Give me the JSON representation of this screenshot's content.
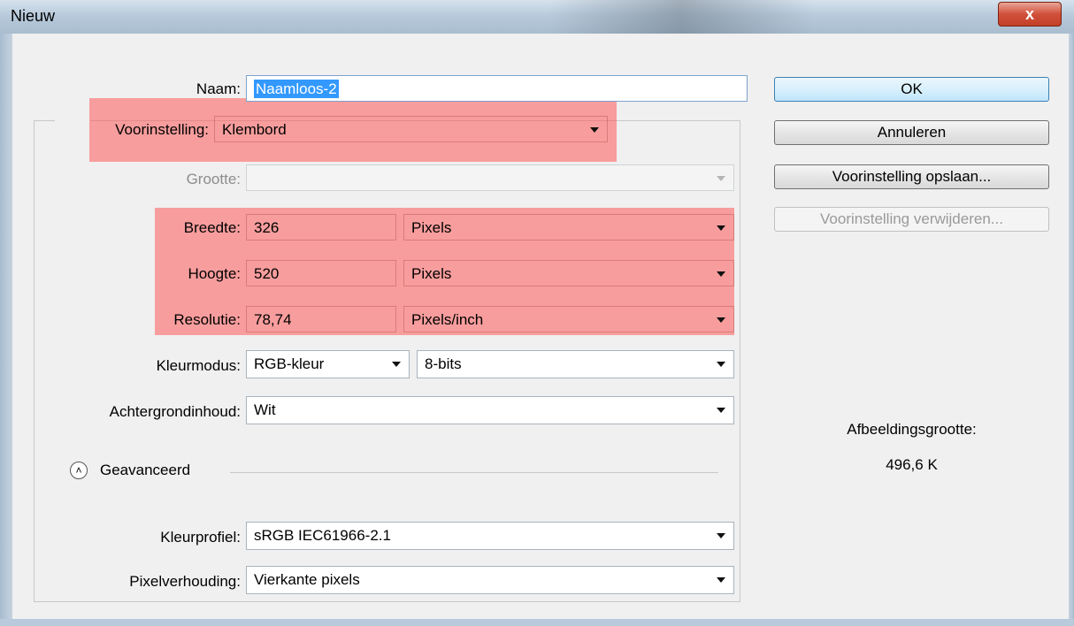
{
  "window": {
    "title": "Nieuw",
    "close_glyph": "x"
  },
  "form": {
    "name": {
      "label": "Naam:",
      "value": "Naamloos-2"
    },
    "preset": {
      "label": "Voorinstelling:",
      "value": "Klembord"
    },
    "size": {
      "label": "Grootte:",
      "value": ""
    },
    "width": {
      "label": "Breedte:",
      "value": "326",
      "unit": "Pixels"
    },
    "height": {
      "label": "Hoogte:",
      "value": "520",
      "unit": "Pixels"
    },
    "resolution": {
      "label": "Resolutie:",
      "value": "78,74",
      "unit": "Pixels/inch"
    },
    "color_mode": {
      "label": "Kleurmodus:",
      "value": "RGB-kleur",
      "bits": "8-bits"
    },
    "background": {
      "label": "Achtergrondinhoud:",
      "value": "Wit"
    },
    "advanced": {
      "label": "Geavanceerd",
      "icon": "collapse-up-icon"
    },
    "color_profile": {
      "label": "Kleurprofiel:",
      "value": "sRGB IEC61966-2.1"
    },
    "pixel_aspect": {
      "label": "Pixelverhouding:",
      "value": "Vierkante pixels"
    }
  },
  "buttons": {
    "ok": "OK",
    "cancel": "Annuleren",
    "save_preset": "Voorinstelling opslaan...",
    "delete_preset": "Voorinstelling verwijderen..."
  },
  "image_size": {
    "label": "Afbeeldingsgrootte:",
    "value": "496,6 K"
  },
  "colors": {
    "highlight": "#ff5a5a",
    "selection": "#3399ff",
    "default_button": "#3c7fb1"
  }
}
